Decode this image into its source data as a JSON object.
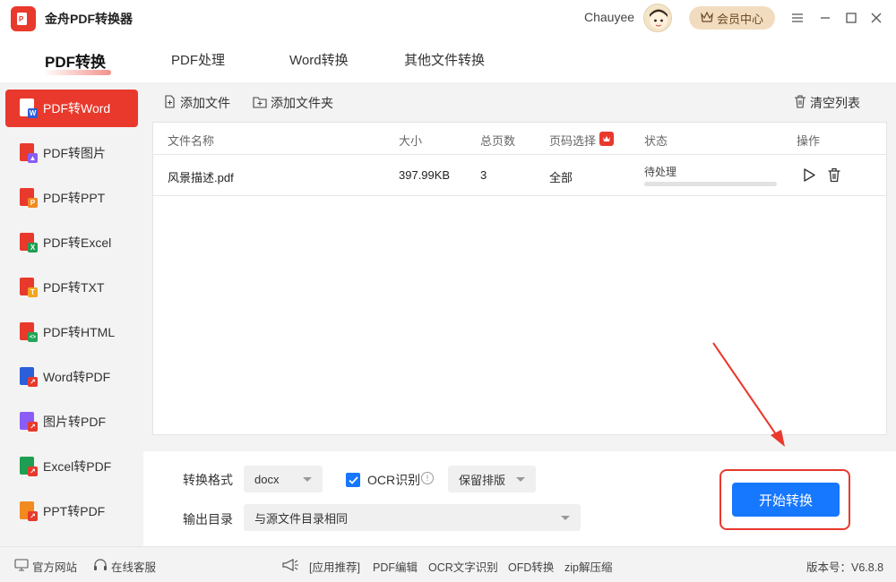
{
  "app": {
    "title": "金舟PDF转换器",
    "username": "Chauyee",
    "vip_label": "会员中心"
  },
  "tabs": [
    {
      "label": "PDF转换",
      "active": true
    },
    {
      "label": "PDF处理"
    },
    {
      "label": "Word转换"
    },
    {
      "label": "其他文件转换"
    }
  ],
  "sidebar": {
    "items": [
      {
        "label": "PDF转Word",
        "badge": "W",
        "badge_color": "#2b5fd9",
        "active": true
      },
      {
        "label": "PDF转图片",
        "badge": "▲",
        "badge_color": "#8a5cf5"
      },
      {
        "label": "PDF转PPT",
        "badge": "P",
        "badge_color": "#f28a1f"
      },
      {
        "label": "PDF转Excel",
        "badge": "X",
        "badge_color": "#1e9e53"
      },
      {
        "label": "PDF转TXT",
        "badge": "T",
        "badge_color": "#f2a51f"
      },
      {
        "label": "PDF转HTML",
        "badge": "<>",
        "badge_color": "#23a55a"
      },
      {
        "label": "Word转PDF",
        "badge": "W",
        "badge_color": "#2b5fd9"
      },
      {
        "label": "图片转PDF",
        "badge": "▲",
        "badge_color": "#8a5cf5"
      },
      {
        "label": "Excel转PDF",
        "badge": "X",
        "badge_color": "#1e9e53"
      },
      {
        "label": "PPT转PDF",
        "badge": "P",
        "badge_color": "#f28a1f"
      }
    ]
  },
  "toolbar": {
    "add_file": "添加文件",
    "add_folder": "添加文件夹",
    "clear_list": "清空列表"
  },
  "table": {
    "columns": [
      "文件名称",
      "大小",
      "总页数",
      "页码选择",
      "状态",
      "操作"
    ],
    "rows": [
      {
        "name": "风景描述.pdf",
        "size": "397.99KB",
        "pages": "3",
        "page_select": "全部",
        "status": "待处理",
        "progress": 0
      }
    ]
  },
  "settings": {
    "format_label": "转换格式",
    "format_value": "docx",
    "ocr_label": "OCR识别",
    "ocr_checked": true,
    "layout_value": "保留排版",
    "output_label": "输出目录",
    "output_value": "与源文件目录相同",
    "start_label": "开始转换"
  },
  "footer": {
    "website": "官方网站",
    "support": "在线客服",
    "app_recommend": "[应用推荐]",
    "links": [
      "PDF编辑",
      "OCR文字识别",
      "OFD转换",
      "zip解压缩"
    ],
    "version": "版本号：V6.8.8"
  },
  "colors": {
    "accent": "#e8392c",
    "primary": "#1677ff"
  }
}
